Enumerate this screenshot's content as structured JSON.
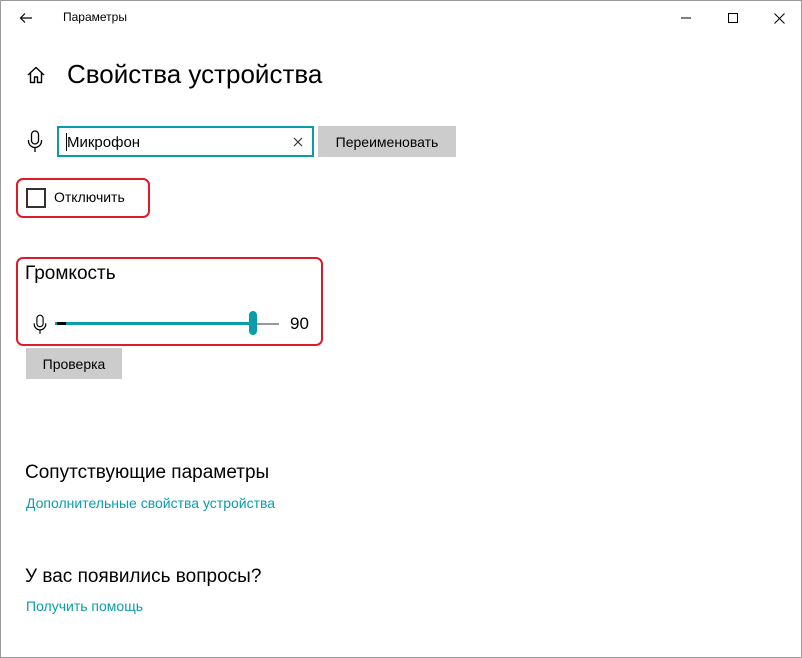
{
  "window": {
    "title": "Параметры",
    "back_icon": "arrow-left-icon",
    "controls": {
      "minimize_icon": "minimize-icon",
      "maximize_icon": "maximize-icon",
      "close_icon": "close-icon"
    }
  },
  "header": {
    "home_icon": "home-icon",
    "title": "Свойства устройства"
  },
  "name_row": {
    "icon": "microphone-icon",
    "input_value": "Микрофон",
    "clear_icon": "clear-x-icon",
    "rename_label": "Переименовать"
  },
  "disable": {
    "checked": false,
    "label": "Отключить"
  },
  "volume": {
    "heading": "Громкость",
    "icon": "microphone-icon",
    "value": "90",
    "level": 90,
    "test_label": "Проверка"
  },
  "related": {
    "heading": "Сопутствующие параметры",
    "link": "Дополнительные свойства устройства"
  },
  "questions": {
    "heading": "У вас появились вопросы?",
    "link": "Получить помощь"
  },
  "colors": {
    "accent": "#0a9cab",
    "highlight": "#e01a2a",
    "button_bg": "#cccccc"
  }
}
